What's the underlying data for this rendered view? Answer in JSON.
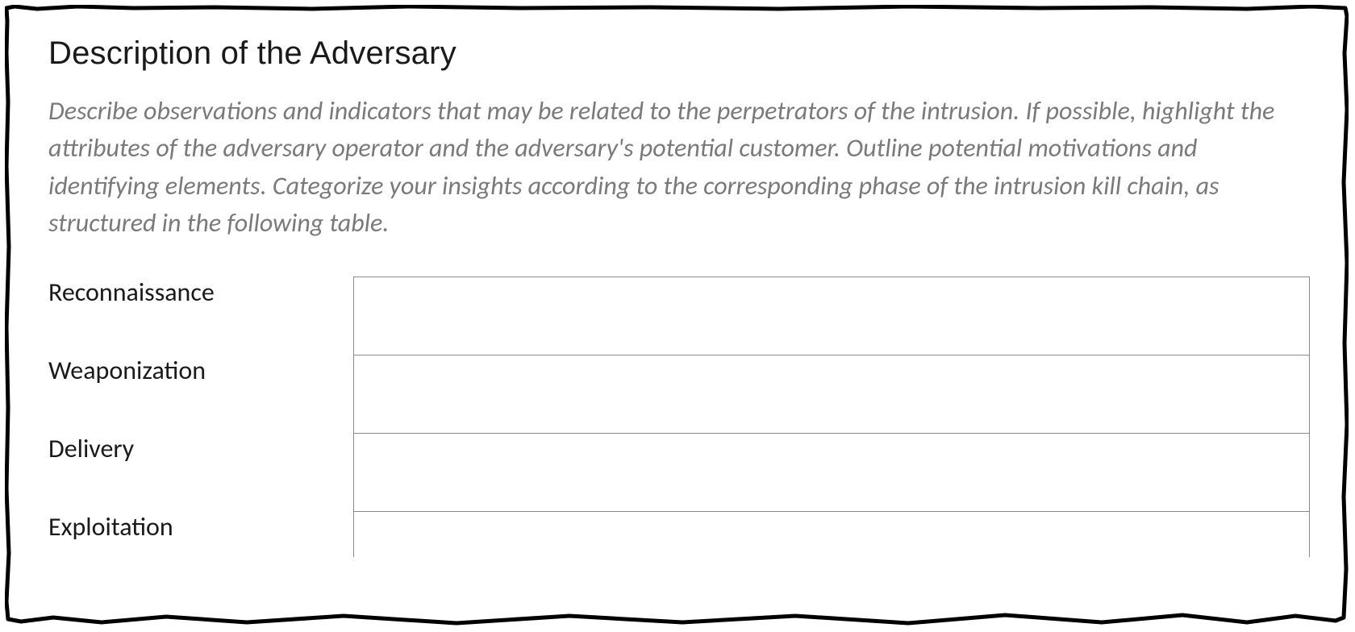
{
  "section": {
    "title": "Description of the Adversary",
    "instructions": "Describe observations and indicators that may be related to the perpetrators of the intrusion. If possible, highlight the attributes of the adversary operator and the adversary's potential customer. Outline potential motivations and identifying elements. Categorize your insights according to the corresponding phase of the intrusion kill chain, as structured in the following table."
  },
  "table": {
    "rows": [
      {
        "label": "Reconnaissance",
        "value": ""
      },
      {
        "label": "Weaponization",
        "value": ""
      },
      {
        "label": "Delivery",
        "value": ""
      },
      {
        "label": "Exploitation",
        "value": ""
      }
    ]
  }
}
